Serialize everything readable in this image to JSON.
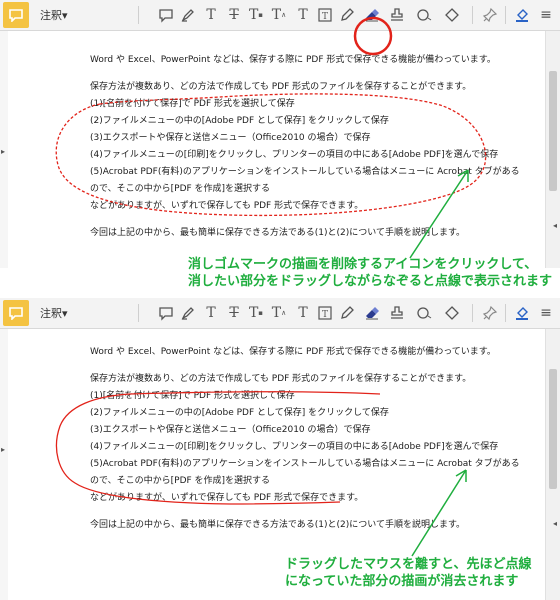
{
  "toolbar": {
    "annotation_menu_label": "注釈▾",
    "tools": [
      {
        "name": "comment-icon",
        "glyph": "💬"
      },
      {
        "name": "highlight-pen-icon",
        "glyph": "✎"
      },
      {
        "name": "text-underline-icon",
        "glyph": "T"
      },
      {
        "name": "text-strikethrough-icon",
        "glyph": "T"
      },
      {
        "name": "text-replace-icon",
        "glyph": "T"
      },
      {
        "name": "text-insert-icon",
        "glyph": "T"
      },
      {
        "name": "typewriter-icon",
        "glyph": "T"
      },
      {
        "name": "textbox-icon",
        "glyph": "T"
      },
      {
        "name": "pencil-icon",
        "glyph": "✎"
      },
      {
        "name": "eraser-icon",
        "glyph": "⌫"
      },
      {
        "name": "stamp-icon",
        "glyph": "⛉"
      },
      {
        "name": "attach-icon",
        "glyph": "⊘"
      },
      {
        "name": "shape-icon",
        "glyph": "◇"
      },
      {
        "name": "pin-icon",
        "glyph": "📌"
      },
      {
        "name": "fill-color-icon",
        "glyph": "◈"
      },
      {
        "name": "more-icon",
        "glyph": "≡"
      }
    ]
  },
  "document": {
    "lines": [
      "Word や Excel、PowerPoint などは、保存する際に PDF 形式で保存できる機能が備わっています。",
      "",
      "保存方法が複数あり、どの方法で作成しても PDF 形式のファイルを保存することができます。",
      "(1)[名前を付けて保存]で PDF 形式を選択して保存",
      "(2)ファイルメニューの中の[Adobe PDF として保存] をクリックして保存",
      "(3)エクスポートや保存と送信メニュー（Office2010 の場合）で保存",
      "(4)ファイルメニューの[印刷]をクリックし、プリンターの項目の中にある[Adobe PDF]を選んで保存",
      "(5)Acrobat PDF(有料)のアプリケーションをインストールしている場合はメニューに Acrobat タブがある",
      "ので、そこの中から[PDF を作成]を選択する",
      "などがありますが、いずれで保存しても PDF 形式で保存できます。",
      "",
      "今回は上記の中から、最も簡単に保存できる方法である(1)と(2)について手順を説明します。"
    ]
  },
  "captions": {
    "top": [
      "消しゴムマークの描画を削除するアイコンをクリックして、",
      "消したい部分をドラッグしながらなぞると点線で表示されます"
    ],
    "bottom": [
      "ドラッグしたマウスを離すと、先ほど点線",
      "になっていた部分の描画が消去されます"
    ]
  },
  "colors": {
    "annotation_red": "#e2231a",
    "caption_green": "#1fae3e",
    "comment_yellow": "#f4c342"
  }
}
